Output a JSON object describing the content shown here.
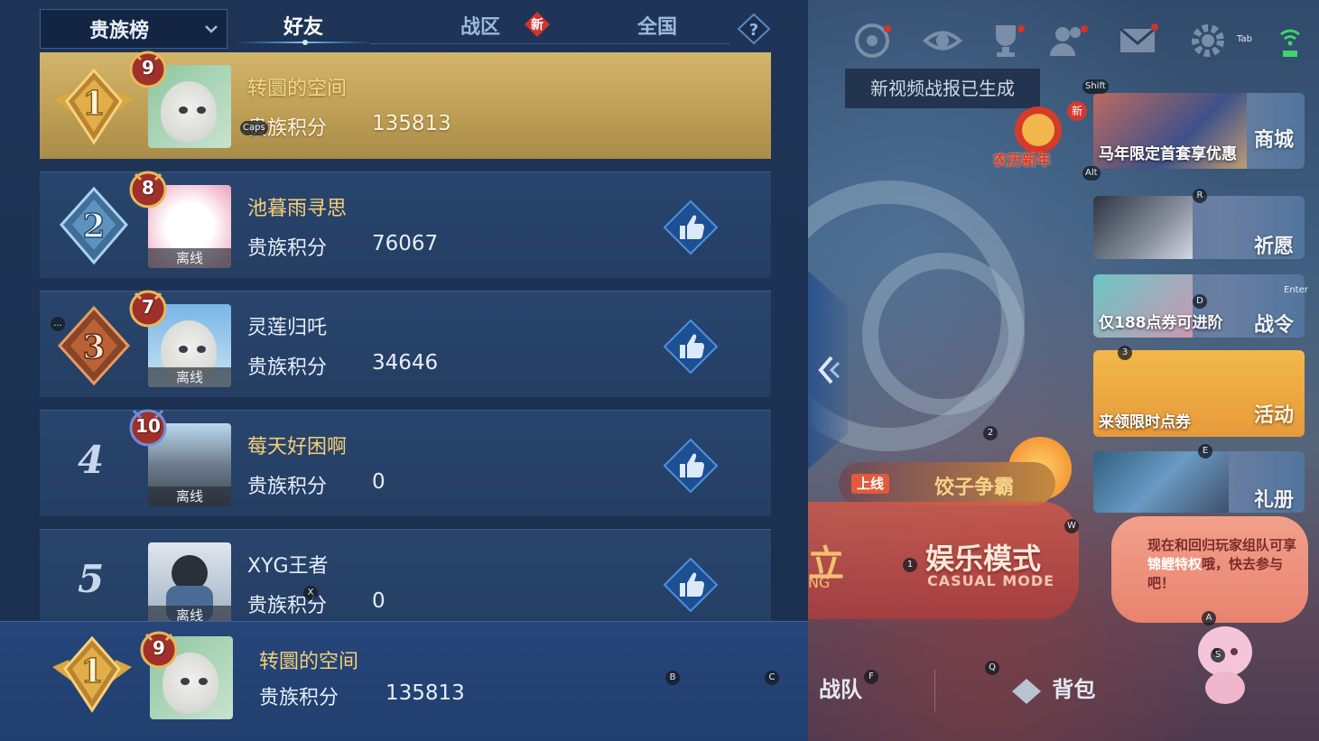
{
  "tabs": {
    "dropdown": "贵族榜",
    "friends": "好友",
    "zone": "战区",
    "zone_badge": "新",
    "national": "全国"
  },
  "score_label": "贵族积分",
  "offline_label": "离线",
  "rows": [
    {
      "rank": "1",
      "level": "9",
      "name": "转圜的空间",
      "score": "135813",
      "offline": false
    },
    {
      "rank": "2",
      "level": "8",
      "name": "池暮雨寻思",
      "score": "76067",
      "offline": true
    },
    {
      "rank": "3",
      "level": "7",
      "name": "灵莲归吒",
      "score": "34646",
      "offline": true
    },
    {
      "rank": "4",
      "level": "10",
      "name": "莓天好困啊",
      "score": "0",
      "offline": true
    },
    {
      "rank": "5",
      "level": "",
      "name": "XYG王者",
      "score": "0",
      "offline": true
    }
  ],
  "self": {
    "rank": "1",
    "level": "9",
    "name": "转圜的空间",
    "score": "135813"
  },
  "game": {
    "toast": "新视频战报已生成",
    "tab_hint": "Tab",
    "new_year": "农历新年",
    "new_year_badge": "新",
    "cards": [
      {
        "title": "商城",
        "caption": "马年限定首套享优惠"
      },
      {
        "title": "祈愿",
        "caption": ""
      },
      {
        "title": "战令",
        "caption": "仅188点券可进阶"
      },
      {
        "title": "活动",
        "caption": "来领限时点券"
      },
      {
        "title": "礼册",
        "caption": ""
      }
    ],
    "event_tag": "上线",
    "event_text": "饺子争霸",
    "mode_cn": "娱乐模式",
    "mode_en": "CASUAL MODE",
    "mode_side": "立",
    "mode_side2": "NG",
    "bubble_pre": "现在和回归玩家组队可享",
    "bubble_hl": "锦鲤特权",
    "bubble_post": "哦，快去参与吧！",
    "team": "战队",
    "bag": "背包"
  },
  "keyhints": {
    "caps": "Caps",
    "shift": "Shift",
    "alt": "Alt",
    "r": "R",
    "d": "D",
    "enter": "Enter",
    "three": "3",
    "two": "2",
    "e": "E",
    "w": "W",
    "one": "1",
    "a": "A",
    "s": "S",
    "f": "F",
    "q": "Q",
    "b": "B",
    "c": "C",
    "x": "X",
    "dots": "..."
  },
  "colors": {
    "gold_row": "#c9a95e",
    "row_bg": "#27436a",
    "accent": "#3fa3ff"
  }
}
